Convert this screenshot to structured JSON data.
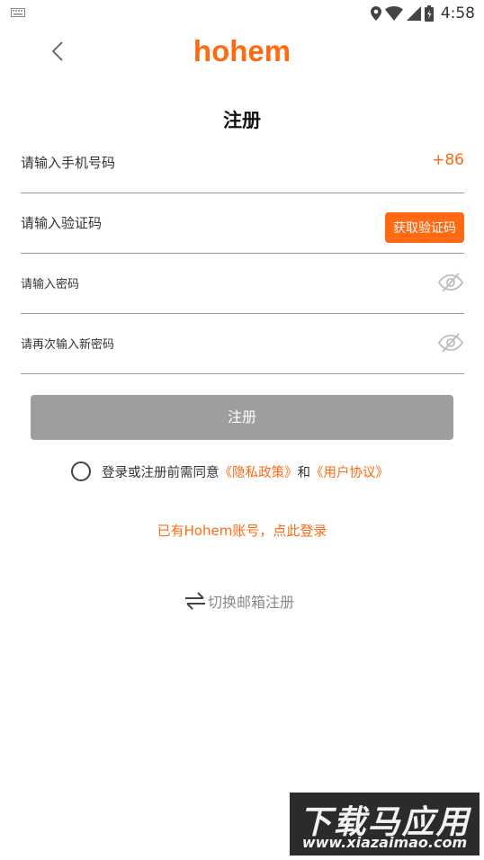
{
  "status_bar": {
    "time": "4:58"
  },
  "header": {
    "logo_text": "hohem"
  },
  "page": {
    "title": "注册"
  },
  "form": {
    "phone": {
      "placeholder": "请输入手机号码",
      "value": "",
      "country_code": "+86"
    },
    "code": {
      "placeholder": "请输入验证码",
      "value": "",
      "button_label": "获取验证码"
    },
    "password": {
      "placeholder": "请输入密码",
      "value": ""
    },
    "confirm_password": {
      "placeholder": "请再次输入新密码",
      "value": ""
    },
    "submit_label": "注册"
  },
  "agreement": {
    "prefix": "登录或注册前需同意",
    "privacy_link": "《隐私政策》",
    "conjunction": "和",
    "terms_link": "《用户协议》",
    "checked": false
  },
  "login_link": "已有Hohem账号，点此登录",
  "switch_email": "切换邮箱注册",
  "watermark": {
    "title": "下载马应用",
    "url": "www.xiazaimao.com"
  },
  "colors": {
    "accent": "#ff6a13",
    "button_disabled": "#9e9e9e"
  }
}
